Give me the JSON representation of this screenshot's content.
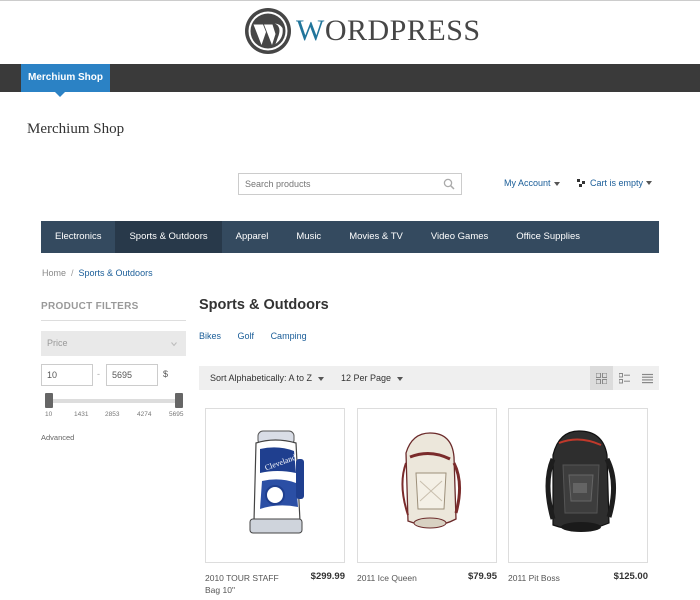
{
  "brand": {
    "wordmark_part1": "W",
    "wordmark_part2": "ORDPRESS",
    "logo_icon": "wordpress-logo-icon"
  },
  "admin_bar": {
    "site_name": "Merchium Shop"
  },
  "shop": {
    "title": "Merchium Shop"
  },
  "search": {
    "placeholder": "Search products",
    "icon": "search-icon"
  },
  "account": {
    "label": "My Account"
  },
  "cart": {
    "label": "Cart is empty",
    "icon": "cart-icon"
  },
  "main_nav": {
    "items": [
      {
        "label": "Electronics"
      },
      {
        "label": "Sports & Outdoors"
      },
      {
        "label": "Apparel"
      },
      {
        "label": "Music"
      },
      {
        "label": "Movies & TV"
      },
      {
        "label": "Video Games"
      },
      {
        "label": "Office Supplies"
      }
    ],
    "active_index": 1
  },
  "breadcrumb": {
    "home": "Home",
    "separator": "/",
    "current": "Sports & Outdoors"
  },
  "filters": {
    "title": "PRODUCT FILTERS",
    "price_label": "Price",
    "min_value": "10",
    "range_dash": "-",
    "max_value": "5695",
    "currency": "$",
    "slider_min_fraction": 0.0,
    "slider_max_fraction": 1.0,
    "ticks": [
      "10",
      "1431",
      "2853",
      "4274",
      "5695"
    ],
    "advanced_label": "Advanced"
  },
  "category": {
    "title": "Sports & Outdoors",
    "subcategories": [
      "Bikes",
      "Golf",
      "Camping"
    ]
  },
  "toolbar": {
    "sort_label": "Sort Alphabetically: A to Z",
    "per_page_label": "12 Per Page",
    "views": [
      "grid-view-icon",
      "list-grid-view-icon",
      "list-view-icon"
    ],
    "active_view_index": 0
  },
  "products": [
    {
      "name": "2010 TOUR STAFF Bag 10\"",
      "price": "$299.99",
      "image_icon": "golf-bag-image"
    },
    {
      "name": "2011 Ice Queen",
      "price": "$79.95",
      "image_icon": "white-backpack-image"
    },
    {
      "name": "2011 Pit Boss",
      "price": "$125.00",
      "image_icon": "black-backpack-image"
    }
  ],
  "colors": {
    "nav_bg": "#344a5f",
    "nav_active": "#28394a",
    "link": "#1a5d98",
    "admin_tab": "#2b82c5"
  }
}
